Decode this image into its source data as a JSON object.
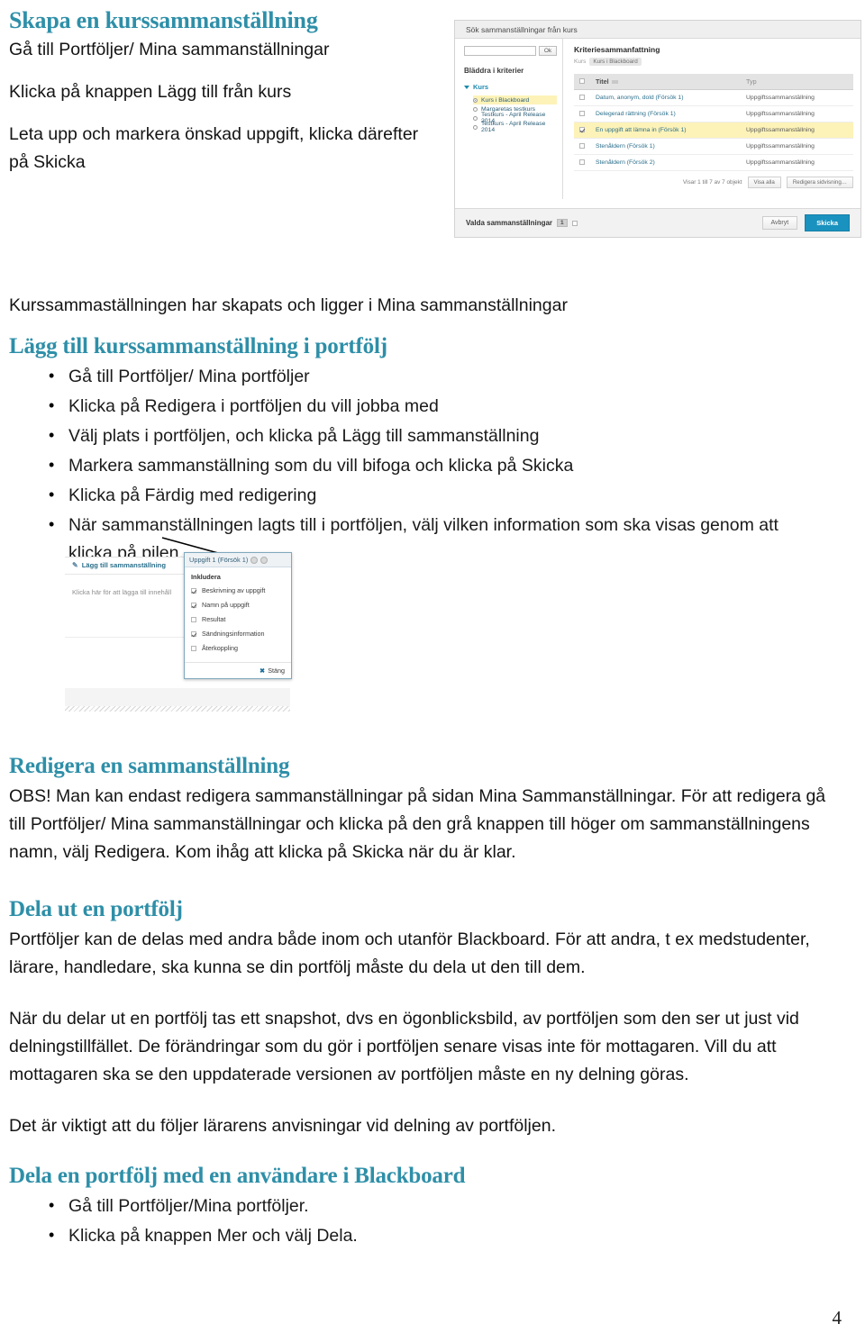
{
  "document": {
    "page_number": "4",
    "accent_color": "#2E8FA8",
    "sections": {
      "s1_heading": "Skapa en kurssammanställning",
      "s1_line1": "Gå till Portföljer/ Mina sammanställningar",
      "s1_line2": "Klicka på knappen Lägg till från kurs",
      "s1_line3": "Leta upp och markera önskad uppgift, klicka därefter på Skicka",
      "s2_line1": "Kurssammaställningen har skapats och ligger i Mina sammanställningar",
      "s2_heading": "Lägg till kurssammanställning i portfölj",
      "s2_bullets": [
        "Gå till Portföljer/ Mina portföljer",
        "Klicka på Redigera i portföljen du vill jobba med",
        "Välj plats i portföljen, och klicka på Lägg till sammanställning",
        "Markera sammanställning som du vill bifoga och klicka på Skicka",
        "Klicka på Färdig med redigering",
        "När sammanställningen lagts till i portföljen, välj vilken information som ska visas genom att klicka på pilen."
      ],
      "s3_heading": "Redigera en sammanställning",
      "s3_paragraph": "OBS! Man kan endast redigera sammanställningar på sidan Mina Sammanställningar. För att redigera gå till Portföljer/ Mina sammanställningar och klicka på den grå knappen till höger om sammanställningens namn, välj Redigera. Kom ihåg att klicka på Skicka när du är klar.",
      "s4_heading": "Dela ut en portfölj",
      "s4_paragraph1": "Portföljer kan de delas med andra både inom och utanför Blackboard. För att andra, t ex medstudenter, lärare, handledare, ska kunna se din portfölj måste du dela ut den till dem.",
      "s4_paragraph2": "När du delar ut en portfölj tas ett snapshot, dvs en ögonblicksbild, av portföljen som den ser ut just vid delningstillfället. De förändringar som du gör i portföljen senare visas inte för mottagaren. Vill du att mottagaren ska se den uppdaterade versionen av portföljen måste en ny delning göras.",
      "s4_paragraph3": "Det är viktigt att du följer lärarens anvisningar vid delning av portföljen.",
      "s5_heading": "Dela en portfölj med en användare i Blackboard",
      "s5_bullets": [
        "Gå till Portföljer/Mina portföljer.",
        "Klicka på knappen Mer och välj Dela."
      ]
    }
  },
  "screenshot1": {
    "window_title": "Sök sammanställningar från kurs",
    "search_placeholder": "",
    "search_value": "",
    "ok_button": "Ok",
    "browse_title": "Bläddra i kriterier",
    "tree_root": "Kurs",
    "tree_items": [
      {
        "label": "Kurs i Blackboard",
        "selected": true
      },
      {
        "label": "Margaretas testkurs",
        "selected": false
      },
      {
        "label": "Testkurs - April Release 2014",
        "selected": false
      },
      {
        "label": "Testkurs - April Release 2014",
        "selected": false
      }
    ],
    "criteria_heading": "Kriteriesammanfattning",
    "crumb_label": "Kurs",
    "crumb_value": "Kurs i Blackboard",
    "columns": [
      "Titel",
      "Typ"
    ],
    "rows": [
      {
        "title": "Datum, anonym, dold (Försök 1)",
        "type": "Uppgiftssammanställning",
        "checked": false,
        "highlight": false
      },
      {
        "title": "Delegerad rättning (Försök 1)",
        "type": "Uppgiftssammanställning",
        "checked": false,
        "highlight": false
      },
      {
        "title": "En uppgift att lämna in (Försök 1)",
        "type": "Uppgiftssammanställning",
        "checked": true,
        "highlight": true
      },
      {
        "title": "Stenåldern (Försök 1)",
        "type": "Uppgiftssammanställning",
        "checked": false,
        "highlight": false
      },
      {
        "title": "Stenåldern (Försök 2)",
        "type": "Uppgiftssammanställning",
        "checked": false,
        "highlight": false
      }
    ],
    "pager_text": "Visar 1 till 7 av 7 objekt",
    "show_all_button": "Visa alla",
    "edit_paging_button": "Redigera sidvisning…",
    "footer_label": "Valda sammanställningar",
    "footer_count": "1",
    "cancel_button": "Avbryt",
    "submit_button": "Skicka"
  },
  "screenshot2": {
    "toolbar_label": "Lägg till sammanställning",
    "placeholder_text": "Klicka här för att lägga till innehåll",
    "popup": {
      "header": "Uppgift 1 (Försök 1)",
      "title": "Inkludera",
      "options": [
        {
          "label": "Beskrivning av uppgift",
          "checked": true
        },
        {
          "label": "Namn på uppgift",
          "checked": true
        },
        {
          "label": "Resultat",
          "checked": false
        },
        {
          "label": "Sändningsinformation",
          "checked": true
        },
        {
          "label": "Återkoppling",
          "checked": false
        }
      ],
      "close_label": "Stäng"
    }
  }
}
